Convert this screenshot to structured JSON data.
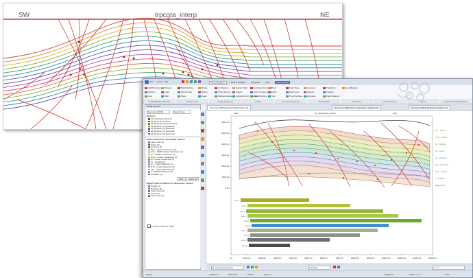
{
  "background_section": {
    "left_label": "SW",
    "center_label": "trpcgta_interp",
    "right_label": "NE"
  },
  "window": {
    "title_tabs": [
      "Model Building",
      "Data & analysis",
      "Templates",
      "View",
      "Document 2D"
    ],
    "quick_toolbar": [
      "File",
      "Home",
      "Edit"
    ],
    "ribbon_groups": [
      "Create/Modify Horizons",
      "Create Lines",
      "Create Polygons",
      "Faults",
      "Construct Horizons",
      "Modify Data",
      "Transform",
      "Create Section",
      "Project",
      "Create and Modify Model"
    ],
    "ribbon_buttons": [
      "Add Structure",
      "Horizon",
      "Line",
      "Polygon",
      "Fault",
      "Wall",
      "Build Surface",
      "Flexure Slip",
      "Move",
      "Rotate",
      "Stamp",
      "Scale",
      "Cut Section",
      "Strike Section",
      "Multiple Sections",
      "Section Split",
      "Project",
      "Horizons From Template",
      "Horizons From Fault",
      "Fault Contact Lines",
      "Fault Structure",
      "Point",
      "Label",
      "Text",
      "Fault Trace",
      "Fault Lines",
      "Trend Surface",
      "Contours",
      "Sample",
      "Envelope",
      "Transform",
      "Imagery",
      "Fault Distance",
      "Area Balance"
    ],
    "doc_tabs": [
      "Document 2D(5) Reinterpreted Section (3)",
      "Document 2D(4) Fault_Restoration_Analysis (2)",
      "Document 2D(3) Restoring_Sections (1)"
    ]
  },
  "model_browser": {
    "title": "Model Browser",
    "toolbar": [
      "Document 2D/3D",
      "Close Views"
    ],
    "section_header": "Sections",
    "items": [
      "01_Interpreted_Section",
      "02_Restore_Surfaces",
      "03_Restored_Reconstructed",
      "04_Restore_01_Restored",
      "05_Restore_02_Restored",
      "06_Restore_03_Restored",
      "07_Restore_04_Restored"
    ],
    "item_colors": [
      "#c03030",
      "#3050c0",
      "#30a040",
      "#c08020",
      "#8040a0",
      "#209090",
      "#c03070"
    ],
    "data_header": "Data in Section 01_Interpreted_Section",
    "data_items": [
      "Fault Lines (1)",
      "Faults (3)",
      "Horizons (9)",
      "Mu1 - Upper Cretaceous (4)",
      "Kmp - Middle Upper Cretaceous (4)",
      "Kv - Middle Cretaceous (4)",
      "Kmm - Lower Cretaceous (4)",
      "Kl - Lower Cretaceous (4)",
      "Ju - Jurassic (4)",
      "Jm - Upper Mesozoic (4)",
      "JLM - Lower Mesozoic (4)",
      "Tpu - Upper Paleozoic (4)",
      "T - Middle Paleozoic (4)",
      "Localities (1)"
    ],
    "data_colors": [
      "#777777",
      "#c03030",
      "#3c6cc0",
      "#b8d070",
      "#d8c060",
      "#e0a060",
      "#a0c070",
      "#60a060",
      "#8080c0",
      "#c080c0",
      "#70b0b0",
      "#c0a080",
      "#a0a0a0",
      "#707070"
    ],
    "filter_buttons": [
      "Filter",
      "Select All"
    ],
    "objects_header": "Object Types in Section 01_Interpreted_Section",
    "object_items": [
      "Images (1)",
      "Polylines (3)",
      "Trace Lines (1)",
      "Points (1)",
      "Fault Lines (1)"
    ],
    "bottom_check": "Include in Selection Path"
  },
  "section_view": {
    "left_header": "Fault",
    "center_header": "01_Interpreted_Section",
    "right_header": "Well",
    "y_ticks": [
      "6000.0m",
      "5000.0m",
      "4000.0m",
      "3000.0m",
      "2000.0m",
      "1000.0m",
      "0.0m"
    ],
    "x_ticks": [
      "0.0",
      "1000.0m",
      "2000.0m",
      "3000.0m",
      "4000.0m",
      "5000.0m",
      "6000.0m",
      "7000.0m",
      "8000.0m",
      "9000.0m",
      "10000.0m",
      "11000.0m",
      "12000.0m",
      "13000.0m"
    ],
    "right_labels": [
      "Mu - Upper",
      "Kmp - Middle",
      "Kv - Middle",
      "Kl - Lower",
      "Ju - Jurassic",
      "Jm - Mesozoic",
      "Tpu - Paleoz",
      "T - Middle",
      "Basement"
    ],
    "strat_lines": [
      "Line 1",
      "Line 2",
      "Line 3",
      "Line 4",
      "Line 5",
      "Line 6",
      "Line 7",
      "Line 8",
      "Line 9",
      "Line 10"
    ]
  },
  "bottom_toolbar": {
    "section_select": "01_Interpreted_Section",
    "zoom": "1:25,000",
    "search_placeholder": "Search"
  },
  "status_bar": {
    "left": "Ready",
    "coords": [
      "7640.31 m",
      "3576.42 m",
      "0.00 m"
    ],
    "units": [
      "Units: m",
      "m"
    ],
    "right_items": [
      "Snapped",
      "Units: m x m",
      "Grid"
    ]
  }
}
